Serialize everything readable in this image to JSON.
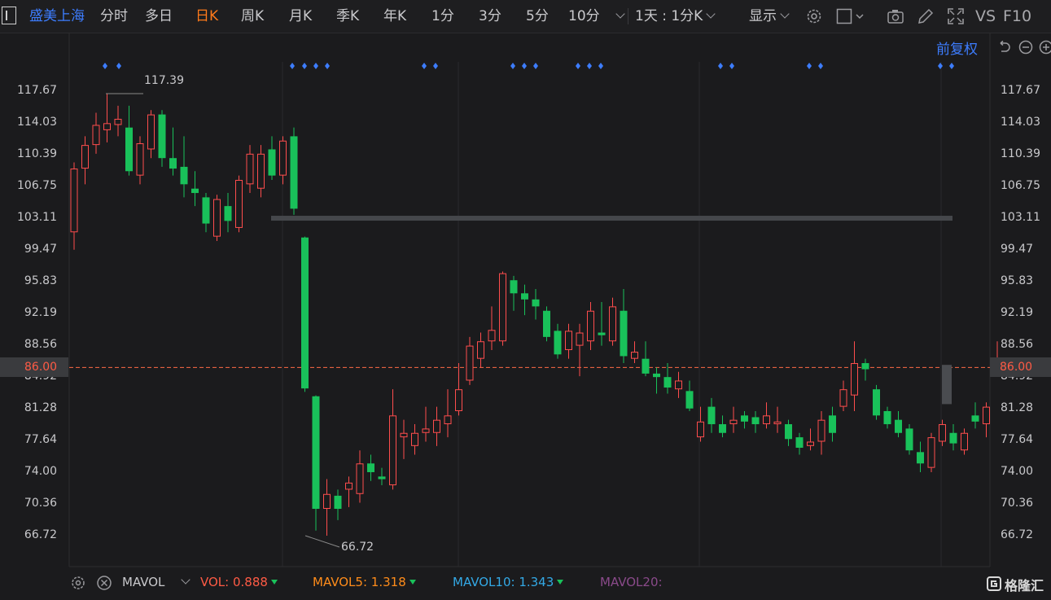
{
  "toolbar": {
    "stock_name": "盛美上海",
    "periods": [
      "分时",
      "多日",
      "日K",
      "周K",
      "月K",
      "季K",
      "年K",
      "1分",
      "3分",
      "5分",
      "10分"
    ],
    "active_period": "日K",
    "interval_select": "1天 : 1分K",
    "display_label": "显示",
    "vs_label": "VS",
    "f10_label": "F10"
  },
  "chart_header": {
    "adjust_label": "前复权"
  },
  "price_axis": {
    "ticks": [
      "117.67",
      "114.03",
      "110.39",
      "106.75",
      "103.11",
      "99.47",
      "95.83",
      "92.19",
      "88.56",
      "84.92",
      "81.28",
      "77.64",
      "74.00",
      "70.36",
      "66.72"
    ],
    "current_price": "86.00"
  },
  "extremes": {
    "high_label": "117.39",
    "low_label": "66.72"
  },
  "indicator_bar": {
    "name": "MAVOL",
    "vol_label": "VOL:",
    "vol_value": "0.888",
    "mavol5_label": "MAVOL5:",
    "mavol5_value": "1.318",
    "mavol10_label": "MAVOL10:",
    "mavol10_value": "1.343",
    "mavol20_label": "MAVOL20:"
  },
  "brand": "格隆汇",
  "colors": {
    "up": "#ff4d4d",
    "down": "#19c15a",
    "accent": "#ff7a1a",
    "link": "#3d7dff"
  },
  "chart_data": {
    "type": "candlestick",
    "ylim": [
      66.72,
      117.67
    ],
    "current_price": 86.0,
    "gap_fill_level": 103.11,
    "candles": [
      {
        "o": 101.5,
        "c": 108.8,
        "h": 109.5,
        "l": 99.5
      },
      {
        "o": 108.8,
        "c": 111.5,
        "h": 112.5,
        "l": 107.0
      },
      {
        "o": 111.5,
        "c": 113.8,
        "h": 115.2,
        "l": 110.5
      },
      {
        "o": 113.2,
        "c": 114.0,
        "h": 117.39,
        "l": 111.8
      },
      {
        "o": 113.8,
        "c": 114.5,
        "h": 116.0,
        "l": 112.5
      },
      {
        "o": 113.5,
        "c": 108.5,
        "h": 116.0,
        "l": 108.0
      },
      {
        "o": 108.0,
        "c": 111.7,
        "h": 112.5,
        "l": 107.0
      },
      {
        "o": 111.0,
        "c": 115.0,
        "h": 115.5,
        "l": 110.0
      },
      {
        "o": 115.0,
        "c": 110.0,
        "h": 115.5,
        "l": 109.0
      },
      {
        "o": 110.0,
        "c": 108.8,
        "h": 113.5,
        "l": 108.0
      },
      {
        "o": 109.0,
        "c": 107.0,
        "h": 112.5,
        "l": 105.5
      },
      {
        "o": 106.5,
        "c": 106.0,
        "h": 108.5,
        "l": 104.5
      },
      {
        "o": 105.5,
        "c": 102.5,
        "h": 106.0,
        "l": 101.5
      },
      {
        "o": 101.0,
        "c": 105.3,
        "h": 105.8,
        "l": 100.5
      },
      {
        "o": 104.5,
        "c": 102.8,
        "h": 106.0,
        "l": 101.5
      },
      {
        "o": 102.0,
        "c": 107.5,
        "h": 108.0,
        "l": 101.5
      },
      {
        "o": 107.0,
        "c": 110.5,
        "h": 111.5,
        "l": 106.0
      },
      {
        "o": 106.5,
        "c": 110.5,
        "h": 111.5,
        "l": 105.5
      },
      {
        "o": 111.0,
        "c": 108.0,
        "h": 112.5,
        "l": 107.5
      },
      {
        "o": 108.0,
        "c": 112.0,
        "h": 112.5,
        "l": 107.0
      },
      {
        "o": 112.5,
        "c": 104.2,
        "h": 113.5,
        "l": 103.5
      },
      {
        "o": 100.9,
        "c": 83.6,
        "h": 101.0,
        "l": 83.2
      },
      {
        "o": 82.7,
        "c": 69.8,
        "h": 82.8,
        "l": 67.3
      },
      {
        "o": 69.8,
        "c": 71.5,
        "h": 73.2,
        "l": 66.72
      },
      {
        "o": 71.3,
        "c": 69.8,
        "h": 72.0,
        "l": 68.5
      },
      {
        "o": 72.0,
        "c": 72.8,
        "h": 73.5,
        "l": 70.0
      },
      {
        "o": 71.5,
        "c": 75.0,
        "h": 76.5,
        "l": 70.5
      },
      {
        "o": 75.0,
        "c": 74.0,
        "h": 76.0,
        "l": 73.0
      },
      {
        "o": 73.5,
        "c": 73.2,
        "h": 74.5,
        "l": 72.5
      },
      {
        "o": 72.5,
        "c": 80.5,
        "h": 83.5,
        "l": 72.0
      },
      {
        "o": 78.0,
        "c": 78.5,
        "h": 80.0,
        "l": 75.5
      },
      {
        "o": 77.0,
        "c": 78.5,
        "h": 79.5,
        "l": 76.0
      },
      {
        "o": 78.5,
        "c": 79.0,
        "h": 81.5,
        "l": 77.5
      },
      {
        "o": 78.5,
        "c": 80.0,
        "h": 81.5,
        "l": 77.0
      },
      {
        "o": 79.5,
        "c": 80.5,
        "h": 83.5,
        "l": 78.0
      },
      {
        "o": 81.0,
        "c": 83.5,
        "h": 86.5,
        "l": 80.5
      },
      {
        "o": 84.5,
        "c": 88.5,
        "h": 89.5,
        "l": 84.0
      },
      {
        "o": 87.0,
        "c": 89.0,
        "h": 90.0,
        "l": 86.0
      },
      {
        "o": 89.0,
        "c": 90.3,
        "h": 93.0,
        "l": 88.0
      },
      {
        "o": 89.0,
        "c": 96.8,
        "h": 97.0,
        "l": 88.5
      },
      {
        "o": 96.0,
        "c": 94.5,
        "h": 96.5,
        "l": 92.5
      },
      {
        "o": 94.5,
        "c": 93.8,
        "h": 95.5,
        "l": 92.0
      },
      {
        "o": 93.8,
        "c": 93.0,
        "h": 95.0,
        "l": 91.5
      },
      {
        "o": 92.5,
        "c": 89.5,
        "h": 93.0,
        "l": 89.0
      },
      {
        "o": 90.2,
        "c": 87.5,
        "h": 91.0,
        "l": 87.0
      },
      {
        "o": 88.0,
        "c": 90.2,
        "h": 91.0,
        "l": 87.0
      },
      {
        "o": 88.5,
        "c": 90.0,
        "h": 91.0,
        "l": 85.0
      },
      {
        "o": 89.0,
        "c": 92.5,
        "h": 93.5,
        "l": 88.0
      },
      {
        "o": 90.0,
        "c": 89.7,
        "h": 93.5,
        "l": 88.5
      },
      {
        "o": 89.0,
        "c": 93.0,
        "h": 94.0,
        "l": 88.5
      },
      {
        "o": 92.5,
        "c": 87.3,
        "h": 95.0,
        "l": 86.5
      },
      {
        "o": 87.0,
        "c": 87.8,
        "h": 89.0,
        "l": 86.5
      },
      {
        "o": 87.0,
        "c": 85.3,
        "h": 89.0,
        "l": 85.0
      },
      {
        "o": 85.3,
        "c": 84.9,
        "h": 86.0,
        "l": 83.0
      },
      {
        "o": 84.9,
        "c": 83.7,
        "h": 86.5,
        "l": 83.0
      },
      {
        "o": 83.5,
        "c": 84.5,
        "h": 85.5,
        "l": 82.5
      },
      {
        "o": 83.3,
        "c": 81.3,
        "h": 84.5,
        "l": 81.0
      },
      {
        "o": 78.0,
        "c": 79.8,
        "h": 81.5,
        "l": 77.5
      },
      {
        "o": 81.5,
        "c": 79.5,
        "h": 82.5,
        "l": 78.5
      },
      {
        "o": 79.5,
        "c": 78.5,
        "h": 80.5,
        "l": 78.0
      },
      {
        "o": 79.5,
        "c": 80.0,
        "h": 81.5,
        "l": 78.5
      },
      {
        "o": 80.5,
        "c": 79.8,
        "h": 81.0,
        "l": 79.0
      },
      {
        "o": 80.3,
        "c": 79.5,
        "h": 81.0,
        "l": 78.5
      },
      {
        "o": 79.5,
        "c": 80.5,
        "h": 82.0,
        "l": 79.0
      },
      {
        "o": 79.5,
        "c": 79.8,
        "h": 81.5,
        "l": 78.5
      },
      {
        "o": 79.5,
        "c": 77.8,
        "h": 80.0,
        "l": 77.0
      },
      {
        "o": 78.0,
        "c": 76.8,
        "h": 78.5,
        "l": 76.0
      },
      {
        "o": 77.0,
        "c": 77.5,
        "h": 79.0,
        "l": 76.5
      },
      {
        "o": 77.5,
        "c": 80.0,
        "h": 81.0,
        "l": 76.0
      },
      {
        "o": 80.5,
        "c": 78.5,
        "h": 81.5,
        "l": 77.5
      },
      {
        "o": 81.5,
        "c": 83.5,
        "h": 84.5,
        "l": 81.0
      },
      {
        "o": 82.8,
        "c": 86.5,
        "h": 89.0,
        "l": 81.0
      },
      {
        "o": 86.5,
        "c": 85.8,
        "h": 87.0,
        "l": 84.5
      },
      {
        "o": 83.5,
        "c": 80.5,
        "h": 84.0,
        "l": 80.0
      },
      {
        "o": 81.0,
        "c": 79.5,
        "h": 81.5,
        "l": 79.0
      },
      {
        "o": 80.0,
        "c": 78.5,
        "h": 81.0,
        "l": 78.0
      },
      {
        "o": 79.0,
        "c": 76.5,
        "h": 79.5,
        "l": 76.0
      },
      {
        "o": 76.3,
        "c": 75.0,
        "h": 77.5,
        "l": 74.0
      },
      {
        "o": 74.5,
        "c": 78.0,
        "h": 78.5,
        "l": 74.0
      },
      {
        "o": 77.5,
        "c": 79.5,
        "h": 80.0,
        "l": 77.0
      },
      {
        "o": 78.5,
        "c": 77.3,
        "h": 79.5,
        "l": 76.5
      },
      {
        "o": 76.5,
        "c": 78.5,
        "h": 79.0,
        "l": 76.0
      },
      {
        "o": 80.5,
        "c": 79.8,
        "h": 82.0,
        "l": 79.0
      },
      {
        "o": 79.5,
        "c": 81.5,
        "h": 82.0,
        "l": 78.0
      },
      {
        "o": 86.0,
        "c": 87.0,
        "h": 89.0,
        "l": 85.0
      }
    ]
  }
}
